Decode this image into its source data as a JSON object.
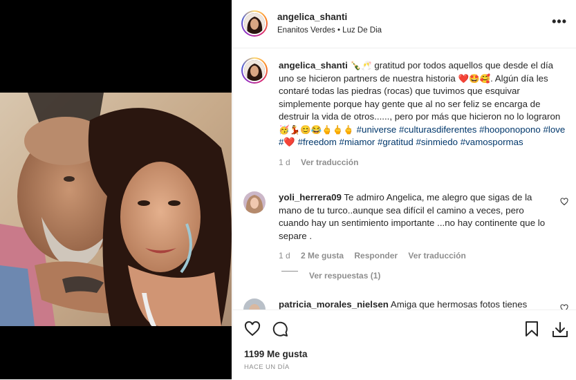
{
  "post": {
    "username": "angelica_shanti",
    "location": "Enanitos Verdes • Luz De Dia"
  },
  "caption": {
    "username": "angelica_shanti",
    "emoji_start": "🍾🥂",
    "text1": "gratitud por todos aquellos que desde el día uno se hicieron partners de nuestra historia",
    "emoji_mid": "❤️🤩🥰",
    "text2": ". Algún día les contaré todas las piedras (rocas) que tuvimos que esquivar simplemente porque hay gente que al no ser feliz se encarga de destruir la vida de otros......, pero por más que hicieron no lo lograron",
    "emoji_end": "🥳💃😊😂🖕🖕🖕",
    "tags": [
      "#universe",
      "#culturasdiferentes",
      "#hooponopono",
      "#love",
      "#❤️",
      "#freedom",
      "#miamor",
      "#gratitud",
      "#sinmiedo",
      "#vamospormas"
    ],
    "time": "1 d",
    "translate": "Ver traducción"
  },
  "comments": [
    {
      "username": "yoli_herrera09",
      "text": "Te admiro Angelica, me alegro que sigas de la mano de tu turco..aunque sea difícil el camino a veces, pero cuando hay un sentimiento importante ...no hay continente que lo separe .",
      "time": "1 d",
      "likes": "2 Me gusta",
      "reply": "Responder",
      "translate": "Ver traducción",
      "view_replies": "Ver respuestas (1)"
    },
    {
      "username": "patricia_morales_nielsen",
      "text": "Amiga que hermosas fotos tienes"
    }
  ],
  "footer": {
    "likes": "1199 Me gusta",
    "time_ago": "HACE UN DÍA"
  },
  "colors": {
    "hashtag": "#00376b",
    "secondary": "#8e8e8e",
    "heart": "#ed4956"
  }
}
